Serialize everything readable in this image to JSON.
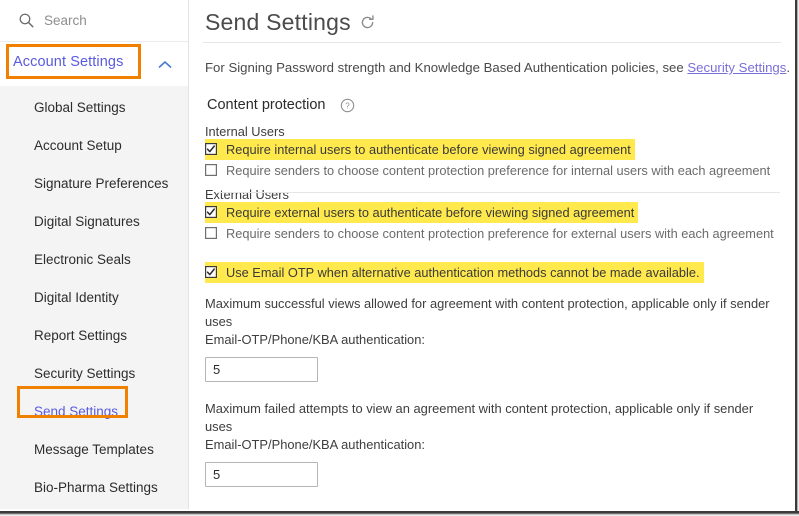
{
  "sidebar": {
    "search": {
      "placeholder": "Search",
      "icon": "search-icon"
    },
    "account_settings": {
      "label": "Account Settings",
      "chevron": "chevron-up-icon",
      "expanded": true,
      "highlight_color": "#f08000"
    },
    "items": [
      {
        "label": "Global Settings",
        "active": false
      },
      {
        "label": "Account Setup",
        "active": false
      },
      {
        "label": "Signature Preferences",
        "active": false
      },
      {
        "label": "Digital Signatures",
        "active": false
      },
      {
        "label": "Electronic Seals",
        "active": false
      },
      {
        "label": "Digital Identity",
        "active": false
      },
      {
        "label": "Report Settings",
        "active": false
      },
      {
        "label": "Security Settings",
        "active": false
      },
      {
        "label": "Send Settings",
        "active": true
      },
      {
        "label": "Message Templates",
        "active": false
      },
      {
        "label": "Bio-Pharma Settings",
        "active": false
      }
    ]
  },
  "main": {
    "title": "Send Settings",
    "refresh_icon": "refresh-icon",
    "intro": {
      "text_before": "For Signing Password strength and Knowledge Based Authentication policies, see ",
      "link_text": "Security Settings",
      "text_after": ".",
      "link_color": "#7a6fd8"
    },
    "section": {
      "heading": "Content protection",
      "help_icon": "question-circle-icon",
      "highlight_color": "#f08000"
    },
    "internal": {
      "subheading": "Internal Users",
      "checkboxes": [
        {
          "label": "Require internal users to authenticate before viewing signed agreement",
          "checked": true,
          "highlighted": true
        },
        {
          "label": "Require senders to choose content protection preference for internal users with each agreement",
          "checked": false,
          "highlighted": false
        }
      ]
    },
    "external": {
      "subheading": "External Users",
      "checkboxes": [
        {
          "label": "Require external users to authenticate before viewing signed agreement",
          "checked": true,
          "highlighted": true
        },
        {
          "label": "Require senders to choose content protection preference for external users with each agreement",
          "checked": false,
          "highlighted": false
        }
      ]
    },
    "otp": {
      "label": "Use Email OTP when alternative authentication methods cannot be made available.",
      "checked": true,
      "highlighted": true
    },
    "max_success": {
      "line1": "Maximum successful views allowed for agreement with content protection, applicable only if sender uses",
      "line2": "Email-OTP/Phone/KBA authentication:",
      "value": "5"
    },
    "max_failed": {
      "line1": "Maximum failed attempts to view an agreement with content protection, applicable only if sender uses",
      "line2": "Email-OTP/Phone/KBA authentication:",
      "value": "5"
    }
  },
  "theme": {
    "highlight_yellow": "#ffe94d",
    "annotation_orange": "#f08000",
    "link_purple": "#5a5ae0"
  }
}
